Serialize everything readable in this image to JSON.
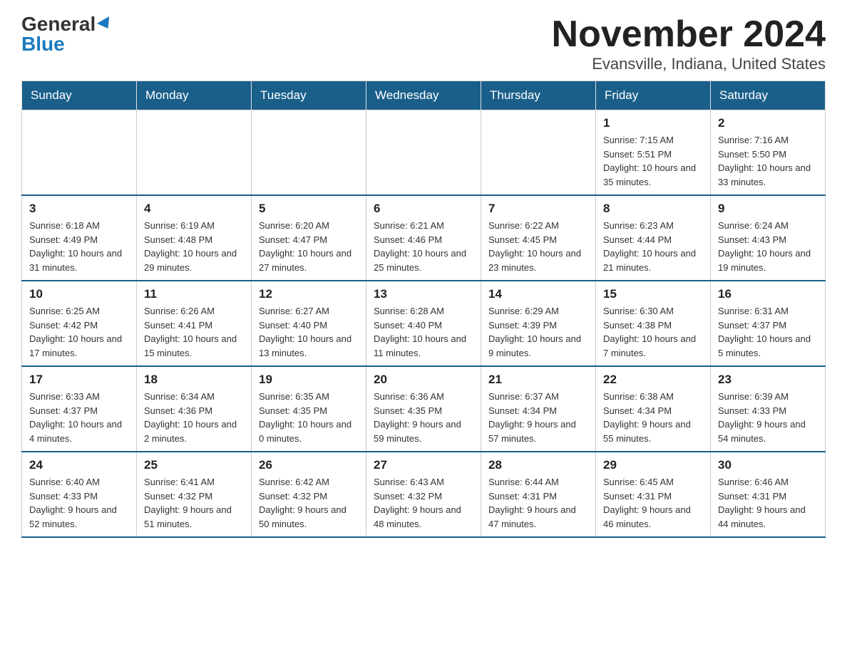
{
  "header": {
    "logo_general": "General",
    "logo_blue": "Blue",
    "title": "November 2024",
    "subtitle": "Evansville, Indiana, United States"
  },
  "weekdays": [
    "Sunday",
    "Monday",
    "Tuesday",
    "Wednesday",
    "Thursday",
    "Friday",
    "Saturday"
  ],
  "weeks": [
    [
      {
        "day": "",
        "info": ""
      },
      {
        "day": "",
        "info": ""
      },
      {
        "day": "",
        "info": ""
      },
      {
        "day": "",
        "info": ""
      },
      {
        "day": "",
        "info": ""
      },
      {
        "day": "1",
        "info": "Sunrise: 7:15 AM\nSunset: 5:51 PM\nDaylight: 10 hours and 35 minutes."
      },
      {
        "day": "2",
        "info": "Sunrise: 7:16 AM\nSunset: 5:50 PM\nDaylight: 10 hours and 33 minutes."
      }
    ],
    [
      {
        "day": "3",
        "info": "Sunrise: 6:18 AM\nSunset: 4:49 PM\nDaylight: 10 hours and 31 minutes."
      },
      {
        "day": "4",
        "info": "Sunrise: 6:19 AM\nSunset: 4:48 PM\nDaylight: 10 hours and 29 minutes."
      },
      {
        "day": "5",
        "info": "Sunrise: 6:20 AM\nSunset: 4:47 PM\nDaylight: 10 hours and 27 minutes."
      },
      {
        "day": "6",
        "info": "Sunrise: 6:21 AM\nSunset: 4:46 PM\nDaylight: 10 hours and 25 minutes."
      },
      {
        "day": "7",
        "info": "Sunrise: 6:22 AM\nSunset: 4:45 PM\nDaylight: 10 hours and 23 minutes."
      },
      {
        "day": "8",
        "info": "Sunrise: 6:23 AM\nSunset: 4:44 PM\nDaylight: 10 hours and 21 minutes."
      },
      {
        "day": "9",
        "info": "Sunrise: 6:24 AM\nSunset: 4:43 PM\nDaylight: 10 hours and 19 minutes."
      }
    ],
    [
      {
        "day": "10",
        "info": "Sunrise: 6:25 AM\nSunset: 4:42 PM\nDaylight: 10 hours and 17 minutes."
      },
      {
        "day": "11",
        "info": "Sunrise: 6:26 AM\nSunset: 4:41 PM\nDaylight: 10 hours and 15 minutes."
      },
      {
        "day": "12",
        "info": "Sunrise: 6:27 AM\nSunset: 4:40 PM\nDaylight: 10 hours and 13 minutes."
      },
      {
        "day": "13",
        "info": "Sunrise: 6:28 AM\nSunset: 4:40 PM\nDaylight: 10 hours and 11 minutes."
      },
      {
        "day": "14",
        "info": "Sunrise: 6:29 AM\nSunset: 4:39 PM\nDaylight: 10 hours and 9 minutes."
      },
      {
        "day": "15",
        "info": "Sunrise: 6:30 AM\nSunset: 4:38 PM\nDaylight: 10 hours and 7 minutes."
      },
      {
        "day": "16",
        "info": "Sunrise: 6:31 AM\nSunset: 4:37 PM\nDaylight: 10 hours and 5 minutes."
      }
    ],
    [
      {
        "day": "17",
        "info": "Sunrise: 6:33 AM\nSunset: 4:37 PM\nDaylight: 10 hours and 4 minutes."
      },
      {
        "day": "18",
        "info": "Sunrise: 6:34 AM\nSunset: 4:36 PM\nDaylight: 10 hours and 2 minutes."
      },
      {
        "day": "19",
        "info": "Sunrise: 6:35 AM\nSunset: 4:35 PM\nDaylight: 10 hours and 0 minutes."
      },
      {
        "day": "20",
        "info": "Sunrise: 6:36 AM\nSunset: 4:35 PM\nDaylight: 9 hours and 59 minutes."
      },
      {
        "day": "21",
        "info": "Sunrise: 6:37 AM\nSunset: 4:34 PM\nDaylight: 9 hours and 57 minutes."
      },
      {
        "day": "22",
        "info": "Sunrise: 6:38 AM\nSunset: 4:34 PM\nDaylight: 9 hours and 55 minutes."
      },
      {
        "day": "23",
        "info": "Sunrise: 6:39 AM\nSunset: 4:33 PM\nDaylight: 9 hours and 54 minutes."
      }
    ],
    [
      {
        "day": "24",
        "info": "Sunrise: 6:40 AM\nSunset: 4:33 PM\nDaylight: 9 hours and 52 minutes."
      },
      {
        "day": "25",
        "info": "Sunrise: 6:41 AM\nSunset: 4:32 PM\nDaylight: 9 hours and 51 minutes."
      },
      {
        "day": "26",
        "info": "Sunrise: 6:42 AM\nSunset: 4:32 PM\nDaylight: 9 hours and 50 minutes."
      },
      {
        "day": "27",
        "info": "Sunrise: 6:43 AM\nSunset: 4:32 PM\nDaylight: 9 hours and 48 minutes."
      },
      {
        "day": "28",
        "info": "Sunrise: 6:44 AM\nSunset: 4:31 PM\nDaylight: 9 hours and 47 minutes."
      },
      {
        "day": "29",
        "info": "Sunrise: 6:45 AM\nSunset: 4:31 PM\nDaylight: 9 hours and 46 minutes."
      },
      {
        "day": "30",
        "info": "Sunrise: 6:46 AM\nSunset: 4:31 PM\nDaylight: 9 hours and 44 minutes."
      }
    ]
  ]
}
